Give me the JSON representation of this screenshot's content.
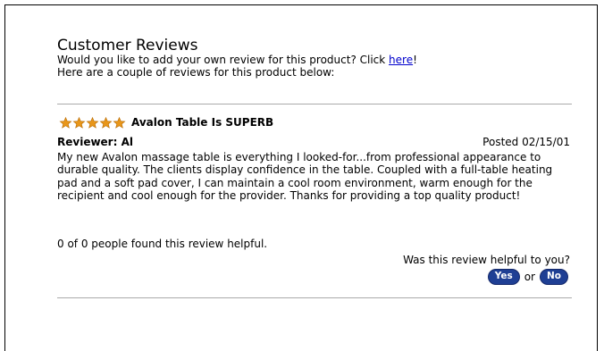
{
  "header": {
    "title": "Customer Reviews",
    "prompt_prefix": "Would you like to add your own review for this product? Click ",
    "prompt_link": "here",
    "prompt_suffix": "!",
    "subtitle": "Here are a couple of reviews for this product below:"
  },
  "review": {
    "rating": 5,
    "rating_max": 5,
    "star_color": "#e8961a",
    "title": "Avalon Table Is SUPERB",
    "reviewer_label": "Reviewer: Al",
    "posted": "Posted 02/15/01",
    "body": "My new Avalon massage table is everything I looked-for...from professional appearance to durable quality. The clients display confidence in the table. Coupled with a full-table heating pad and a soft pad cover, I can maintain a cool room environment, warm enough for the recipient and cool enough for the provider. Thanks for providing a top quality product!",
    "helpful_count_text": "0 of 0 people found this review helpful.",
    "helpful_question": "Was this review helpful to you?",
    "yes_label": "Yes",
    "or_text": "or",
    "no_label": "No",
    "button_color": "#1f3f94"
  }
}
